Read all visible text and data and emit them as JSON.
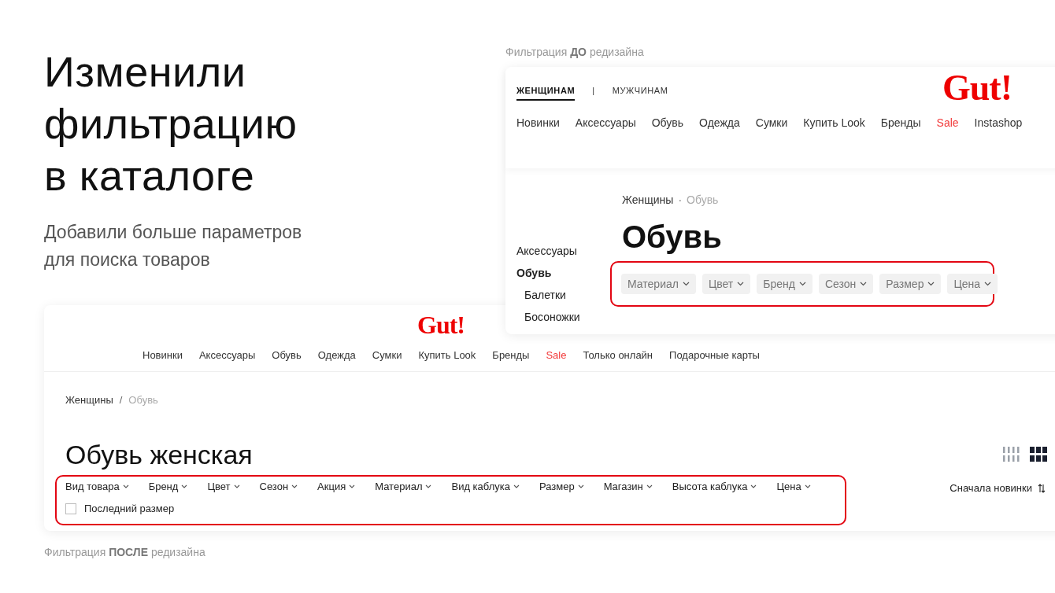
{
  "hero": {
    "title_lines": [
      "Изменили",
      "фильтрацию",
      "в каталоге"
    ],
    "subtitle_lines": [
      "Добавили больше параметров",
      "для поиска товаров"
    ]
  },
  "before": {
    "caption": "Фильтрация **ДО** редизайна",
    "gender_tabs": [
      {
        "label": "ЖЕНЩИНАМ",
        "selected": true
      },
      {
        "label": "МУЖЧИНАМ",
        "selected": false
      }
    ],
    "separator": "|",
    "logo": "Gut!",
    "nav": [
      {
        "label": "Новинки",
        "sale": false
      },
      {
        "label": "Аксессуары",
        "sale": false
      },
      {
        "label": "Обувь",
        "sale": false
      },
      {
        "label": "Одежда",
        "sale": false
      },
      {
        "label": "Сумки",
        "sale": false
      },
      {
        "label": "Купить Look",
        "sale": false
      },
      {
        "label": "Бренды",
        "sale": false
      },
      {
        "label": "Sale",
        "sale": true
      },
      {
        "label": "Instashop",
        "sale": false
      }
    ],
    "breadcrumbs": [
      {
        "label": "Женщины",
        "current": false
      },
      {
        "label": "Обувь",
        "current": true
      }
    ],
    "breadcrumb_separator": "·",
    "sidebar": [
      {
        "label": "Аксессуары",
        "selected": false
      },
      {
        "label": "Обувь",
        "selected": true,
        "children": [
          {
            "label": "Балетки",
            "selected": false
          },
          {
            "label": "Босоножки",
            "selected": false
          }
        ]
      }
    ],
    "title": "Обувь",
    "filters": [
      "Материал",
      "Цвет",
      "Бренд",
      "Сезон",
      "Размер",
      "Цена"
    ]
  },
  "after": {
    "logo": "Gut!",
    "nav": [
      {
        "label": "Новинки",
        "sale": false
      },
      {
        "label": "Аксессуары",
        "sale": false
      },
      {
        "label": "Обувь",
        "sale": false
      },
      {
        "label": "Одежда",
        "sale": false
      },
      {
        "label": "Сумки",
        "sale": false
      },
      {
        "label": "Купить Look",
        "sale": false
      },
      {
        "label": "Бренды",
        "sale": false
      },
      {
        "label": "Sale",
        "sale": true
      },
      {
        "label": "Только онлайн",
        "sale": false
      },
      {
        "label": "Подарочные карты",
        "sale": false
      }
    ],
    "breadcrumbs": [
      {
        "label": "Женщины",
        "current": false
      },
      {
        "label": "Обувь",
        "current": true
      }
    ],
    "breadcrumb_separator": "/",
    "title": "Обувь женская",
    "view_options": [
      {
        "kind": "small",
        "selected": false
      },
      {
        "kind": "large",
        "selected": true
      }
    ],
    "filters": [
      "Вид товара",
      "Бренд",
      "Цвет",
      "Сезон",
      "Акция",
      "Материал",
      "Вид каблука",
      "Размер",
      "Магазин",
      "Высота каблука",
      "Цена"
    ],
    "checkbox": {
      "label": "Последний размер",
      "checked": false
    },
    "sort": "Сначала новинки",
    "caption": "Фильтрация **ПОСЛЕ** редизайна"
  }
}
